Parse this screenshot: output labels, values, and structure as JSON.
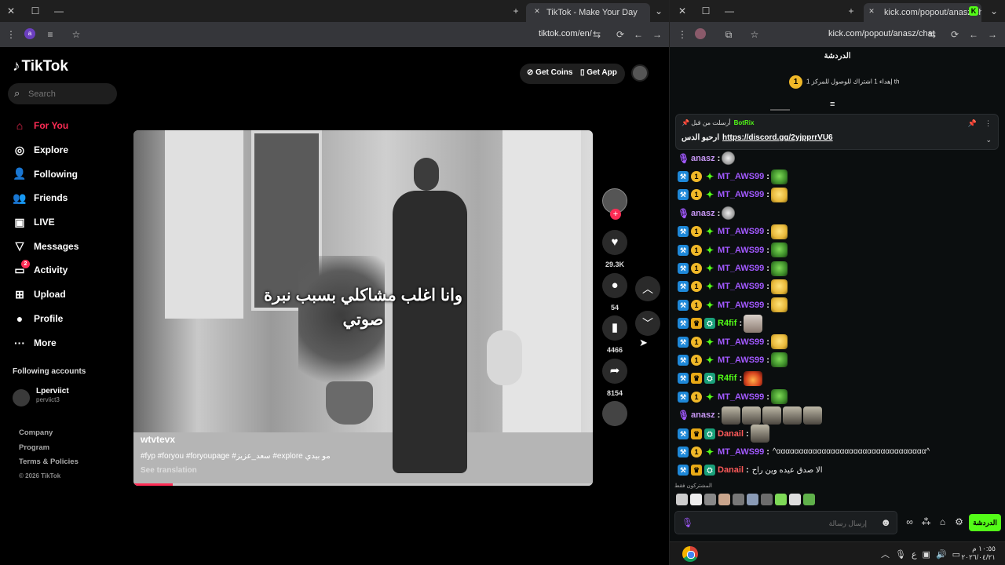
{
  "left_browser": {
    "window_controls": {
      "close": "✕",
      "maximize": "☐",
      "minimize": "—"
    },
    "new_tab": "+",
    "tab_title": "TikTok - Make Your Day",
    "tab_dropdown": "⌄",
    "profile_badge": "a",
    "url": "tiktok.com/en/",
    "nav_icons": [
      "⟳",
      "←",
      "→"
    ]
  },
  "tiktok": {
    "logo": "TikTok",
    "search_placeholder": "Search",
    "nav": [
      {
        "label": "For You",
        "icon": "home-icon",
        "glyph": "⌂"
      },
      {
        "label": "Explore",
        "icon": "compass-icon",
        "glyph": "◎"
      },
      {
        "label": "Following",
        "icon": "following-icon",
        "glyph": "👤"
      },
      {
        "label": "Friends",
        "icon": "friends-icon",
        "glyph": "👥"
      },
      {
        "label": "LIVE",
        "icon": "live-icon",
        "glyph": "▣"
      },
      {
        "label": "Messages",
        "icon": "messages-icon",
        "glyph": "▽"
      },
      {
        "label": "Activity",
        "icon": "activity-icon",
        "glyph": "▭",
        "badge": "2"
      },
      {
        "label": "Upload",
        "icon": "upload-icon",
        "glyph": "⊞"
      },
      {
        "label": "Profile",
        "icon": "profile-icon",
        "glyph": "●"
      },
      {
        "label": "More",
        "icon": "more-icon",
        "glyph": "···"
      }
    ],
    "following_accounts_title": "Following accounts",
    "account": {
      "name": "Lperviict",
      "handle": "perviict3"
    },
    "footer": [
      "Company",
      "Program",
      "Terms & Policies"
    ],
    "copyright": "© 2026 TikTok",
    "get_coins": "Get Coins",
    "get_app": "Get App",
    "video": {
      "caption_line1": "وانا اغلب مشاكلي بسبب نبرة",
      "caption_line2": "صوتي",
      "username": "wtvtevx",
      "tags": "#fyp #foryou #foryoupage #سعد_عزيز #explore مو بيدي",
      "see_translation": "See translation",
      "progress": 0.085
    },
    "actions": {
      "likes": "29.3K",
      "comments": "54",
      "saves": "4466",
      "shares": "8154"
    }
  },
  "right_browser": {
    "tab_title": "kick.com/popout/anasz/chat",
    "url": "kick.com/popout/anasz/chat"
  },
  "kick": {
    "chat_title": "الدردشة",
    "goal_text": "إهداء 1 اشتراك للوصول للمركز 1 th",
    "goal_badge": "1",
    "pinned": {
      "pinned_by": "أرسلت من قبل",
      "author": "BotRix",
      "prefix": "ارحبو الدس",
      "link": "https://discord.gg/2yjpprrVU6"
    },
    "messages": [
      {
        "user": "anasz",
        "color": "#c797f4",
        "type": "host",
        "emote": "hand"
      },
      {
        "user": "MT_AWS99",
        "color": "#a259ff",
        "type": "og",
        "emote": "green"
      },
      {
        "user": "MT_AWS99",
        "color": "#a259ff",
        "type": "og",
        "emote": "yellow"
      },
      {
        "user": "anasz",
        "color": "#c797f4",
        "type": "host",
        "emote": "hand"
      },
      {
        "user": "MT_AWS99",
        "color": "#a259ff",
        "type": "og",
        "emote": "yellow"
      },
      {
        "user": "MT_AWS99",
        "color": "#a259ff",
        "type": "og",
        "emote": "green"
      },
      {
        "user": "MT_AWS99",
        "color": "#a259ff",
        "type": "og",
        "emote": "green"
      },
      {
        "user": "MT_AWS99",
        "color": "#a259ff",
        "type": "og",
        "emote": "yellow"
      },
      {
        "user": "MT_AWS99",
        "color": "#a259ff",
        "type": "og",
        "emote": "yellow"
      },
      {
        "user": "R4fif",
        "color": "#53fc18",
        "type": "vip",
        "emote": "face"
      },
      {
        "user": "MT_AWS99",
        "color": "#a259ff",
        "type": "og",
        "emote": "yellow"
      },
      {
        "user": "MT_AWS99",
        "color": "#a259ff",
        "type": "og",
        "emote": "green"
      },
      {
        "user": "R4fif",
        "color": "#53fc18",
        "type": "vip",
        "emote": "fire"
      },
      {
        "user": "MT_AWS99",
        "color": "#a259ff",
        "type": "og",
        "emote": "green"
      },
      {
        "user": "anasz",
        "color": "#c797f4",
        "type": "host",
        "emote": "spike5"
      },
      {
        "user": "Danail",
        "color": "#ff5a5a",
        "type": "vip",
        "emote": "spike"
      },
      {
        "user": "MT_AWS99",
        "color": "#a259ff",
        "type": "og",
        "text": "^ααααααααααααααααααααααααααααααααα^"
      },
      {
        "user": "Danail",
        "color": "#ff5a5a",
        "type": "vip",
        "text": "الا صدق عيده وين راح"
      }
    ],
    "subscribers_label": "المشتركون فقط",
    "input_placeholder": "إرسال رسالة",
    "send": "الدردشة"
  },
  "taskbar": {
    "tray_lang": "ع",
    "time": "١٠:٥٥ م",
    "date": "٢٠٢٦/٠٤/٢١"
  }
}
